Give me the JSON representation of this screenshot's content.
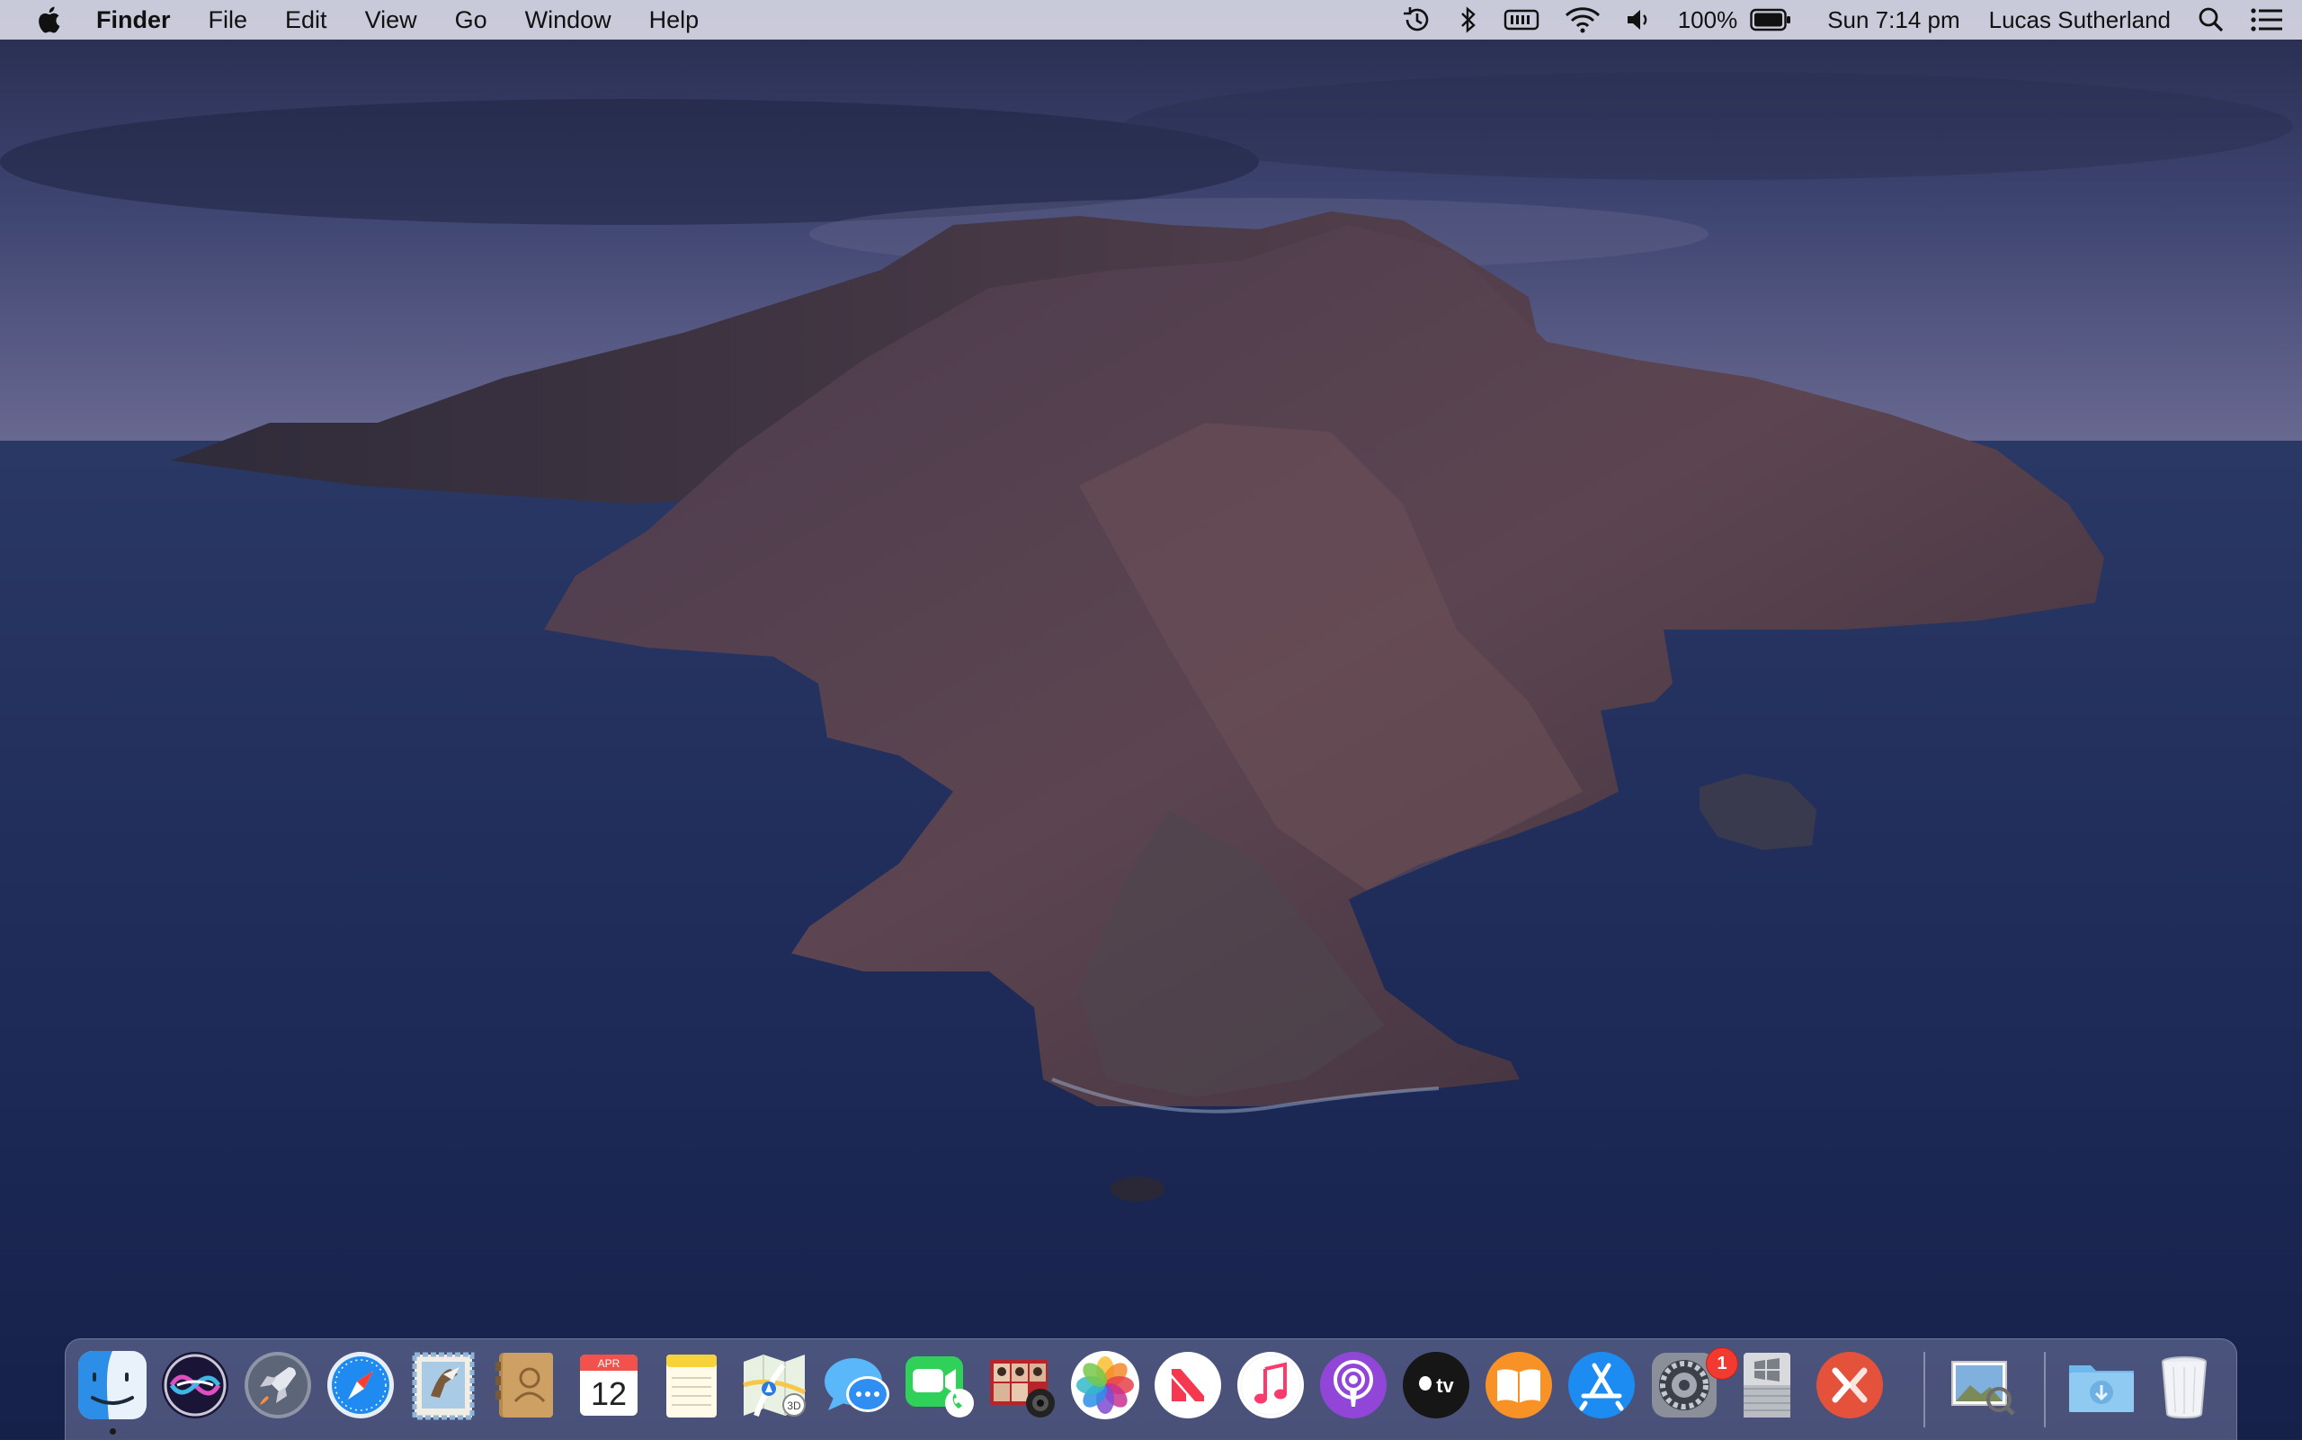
{
  "menubar": {
    "apple": "apple-icon",
    "app_name": "Finder",
    "menus": [
      "File",
      "Edit",
      "View",
      "Go",
      "Window",
      "Help"
    ],
    "status": {
      "battery_percent": "100%",
      "datetime": "Sun 7:14 pm",
      "user": "Lucas Sutherland"
    },
    "status_icons": [
      "time-machine-icon",
      "bluetooth-icon",
      "keyboard-battery-icon",
      "wifi-icon",
      "volume-icon",
      "battery-icon",
      "spotlight-icon",
      "notification-center-icon"
    ]
  },
  "dock": {
    "apps": [
      {
        "name": "Finder",
        "icon": "finder-icon",
        "running": true
      },
      {
        "name": "Siri",
        "icon": "siri-icon"
      },
      {
        "name": "Launchpad",
        "icon": "launchpad-icon"
      },
      {
        "name": "Safari",
        "icon": "safari-icon"
      },
      {
        "name": "Mail",
        "icon": "mail-icon"
      },
      {
        "name": "Contacts",
        "icon": "contacts-icon"
      },
      {
        "name": "Calendar",
        "icon": "calendar-icon",
        "month": "APR",
        "day": "12"
      },
      {
        "name": "Notes",
        "icon": "notes-icon"
      },
      {
        "name": "Maps",
        "icon": "maps-icon",
        "label": "3D"
      },
      {
        "name": "Messages",
        "icon": "messages-icon"
      },
      {
        "name": "FaceTime",
        "icon": "facetime-icon"
      },
      {
        "name": "Photo Booth",
        "icon": "photo-booth-icon"
      },
      {
        "name": "Photos",
        "icon": "photos-icon"
      },
      {
        "name": "News",
        "icon": "news-icon"
      },
      {
        "name": "Music",
        "icon": "music-icon"
      },
      {
        "name": "Podcasts",
        "icon": "podcasts-icon"
      },
      {
        "name": "TV",
        "icon": "tv-icon",
        "label": "tv"
      },
      {
        "name": "Books",
        "icon": "books-icon"
      },
      {
        "name": "App Store",
        "icon": "app-store-icon"
      },
      {
        "name": "System Preferences",
        "icon": "system-preferences-icon",
        "badge": "1"
      },
      {
        "name": "Boot Camp Assistant",
        "icon": "boot-camp-icon"
      },
      {
        "name": "Remote Desktop",
        "icon": "remote-desktop-icon"
      },
      {
        "name": "Preview",
        "icon": "preview-icon"
      },
      {
        "name": "Downloads",
        "icon": "downloads-folder-icon"
      },
      {
        "name": "Trash",
        "icon": "trash-icon"
      }
    ]
  },
  "colors": {
    "menubar_bg": "#d6d6e4",
    "sky_top": "#2b3156",
    "sea": "#1f2d5e",
    "badge": "#f23a30"
  }
}
